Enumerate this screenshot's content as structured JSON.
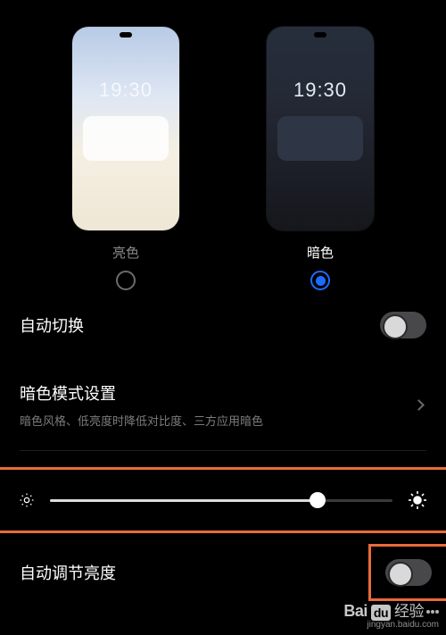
{
  "theme": {
    "preview_time": "19:30",
    "light_label": "亮色",
    "dark_label": "暗色",
    "selected": "dark"
  },
  "auto_switch": {
    "label": "自动切换",
    "enabled": false
  },
  "dark_settings": {
    "title": "暗色模式设置",
    "subtitle": "暗色风格、低亮度时降低对比度、三方应用暗色"
  },
  "brightness": {
    "value_percent": 78
  },
  "auto_brightness": {
    "label": "自动调节亮度",
    "enabled": false
  },
  "watermark": {
    "brand_left": "Bai",
    "brand_box": "du",
    "brand_right": "经验",
    "domain": "jingyan.baidu.com"
  },
  "highlight_color": "#e96a3a"
}
